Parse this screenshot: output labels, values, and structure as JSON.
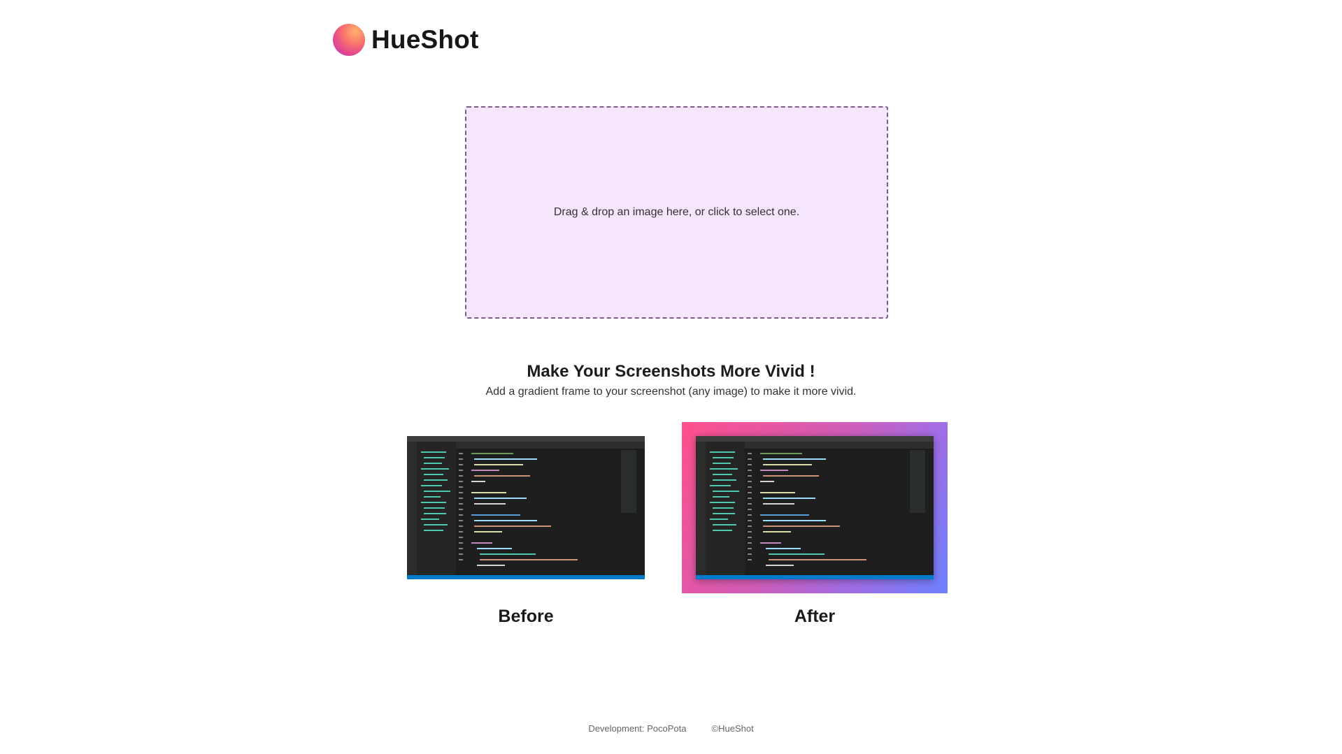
{
  "header": {
    "logo_text": "HueShot"
  },
  "dropzone": {
    "text": "Drag & drop an image here, or click to select one."
  },
  "intro": {
    "heading": "Make Your Screenshots More Vivid !",
    "subheading": "Add a gradient frame to your screenshot (any image) to make it more vivid."
  },
  "examples": {
    "before_label": "Before",
    "after_label": "After"
  },
  "footer": {
    "developer": "Development: PocoPota",
    "copyright": "©HueShot"
  },
  "colors": {
    "dropzone_bg": "#f5e5fd",
    "dropzone_border": "#7b5b85",
    "after_gradient_start": "#ff4f8b",
    "after_gradient_end": "#6c80ff"
  }
}
